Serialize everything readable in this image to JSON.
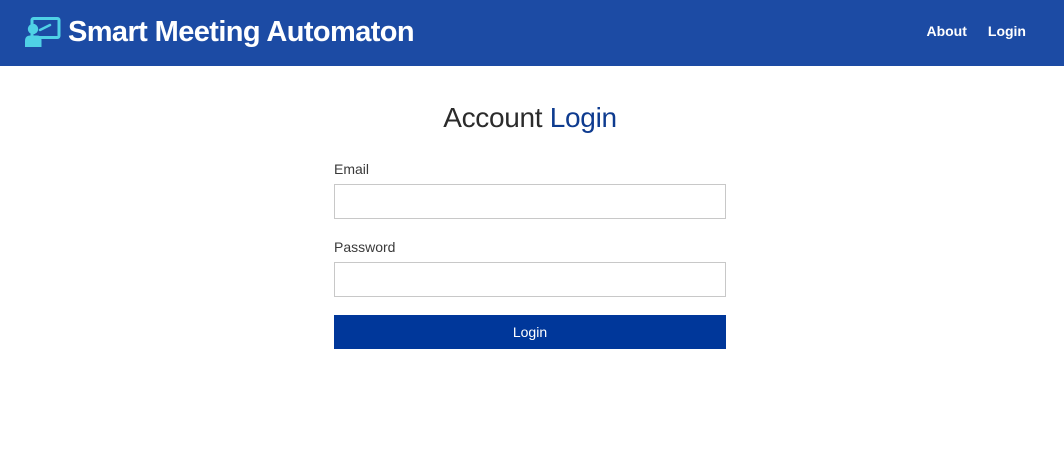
{
  "navbar": {
    "brand_icon": "presentation-user-icon",
    "brand_title": "Smart Meeting Automaton",
    "links": [
      {
        "label": "About"
      },
      {
        "label": "Login"
      }
    ]
  },
  "main": {
    "heading_part1": "Account",
    "heading_part2": "Login",
    "form": {
      "email_label": "Email",
      "email_value": "",
      "password_label": "Password",
      "password_value": "",
      "submit_label": "Login"
    }
  },
  "colors": {
    "navbar_bg": "#1c4ba4",
    "brand_icon": "#4fd1e6",
    "accent": "#0e3b8f",
    "button_bg": "#00379a"
  }
}
